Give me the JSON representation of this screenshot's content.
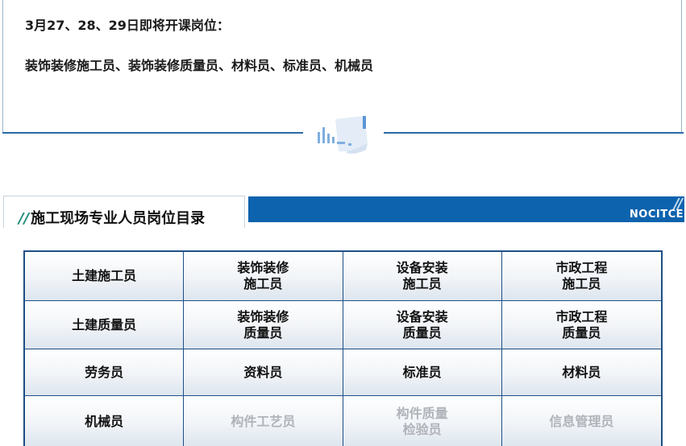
{
  "notice": {
    "dates_line": "3月27、28、29日即将开课岗位：",
    "positions_line": "装饰装修施工员、装饰装修质量员、材料员、标准员、机械员"
  },
  "section": {
    "slashes": "//",
    "title": "施工现场专业人员岗位目录",
    "banner_slashes": "//",
    "banner_text": "NOCITCE"
  },
  "colors": {
    "accent_blue": "#0d63ad",
    "divider_blue": "#2a6aa8",
    "slash_green": "#1f8a78",
    "disabled_text": "#b0b4ba"
  },
  "icons": {
    "divider_icon": "document-chart-icon"
  },
  "grid": {
    "rows": [
      [
        {
          "label": "土建施工员",
          "active": true
        },
        {
          "label": "装饰装修\n施工员",
          "active": true
        },
        {
          "label": "设备安装\n施工员",
          "active": true
        },
        {
          "label": "市政工程\n施工员",
          "active": true
        }
      ],
      [
        {
          "label": "土建质量员",
          "active": true
        },
        {
          "label": "装饰装修\n质量员",
          "active": true
        },
        {
          "label": "设备安装\n质量员",
          "active": true
        },
        {
          "label": "市政工程\n质量员",
          "active": true
        }
      ],
      [
        {
          "label": "劳务员",
          "active": true
        },
        {
          "label": "资料员",
          "active": true
        },
        {
          "label": "标准员",
          "active": true
        },
        {
          "label": "材料员",
          "active": true
        }
      ],
      [
        {
          "label": "机械员",
          "active": true
        },
        {
          "label": "构件工艺员",
          "active": false
        },
        {
          "label": "构件质量\n检验员",
          "active": false
        },
        {
          "label": "信息管理员",
          "active": false
        }
      ]
    ]
  }
}
